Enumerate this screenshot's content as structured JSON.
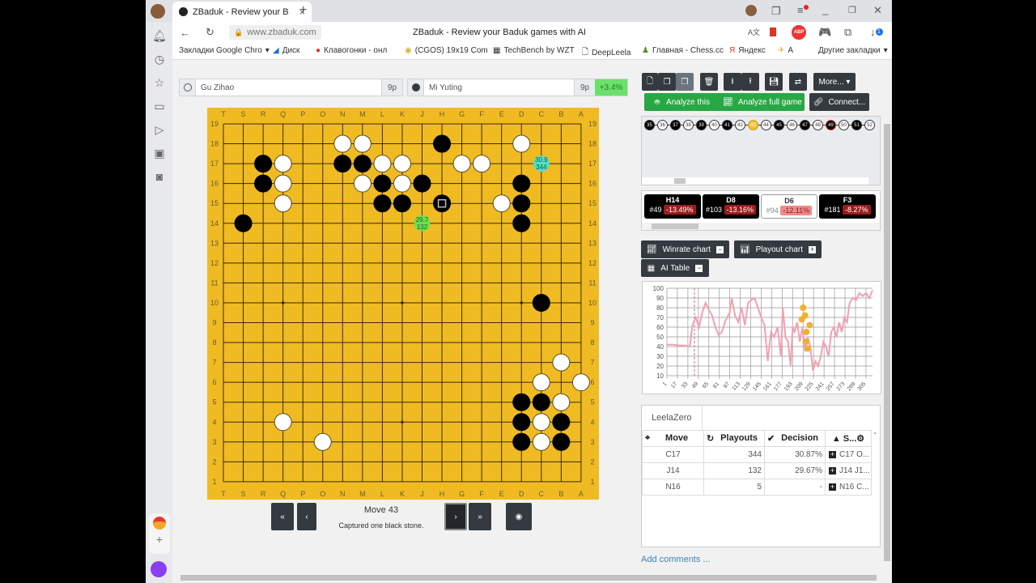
{
  "browser": {
    "tab_title": "ZBaduk - Review your B",
    "url": "www.zbaduk.com",
    "page_title": "ZBaduk - Review your Baduk games with AI",
    "bookmarks": [
      "Закладки Google Chro",
      "Диск",
      "Клавогонки - онл",
      "(CGOS) 19x19 Com",
      "TechBench by WZT",
      "DeepLeela",
      "Главная - Chess.cc",
      "Яндекс",
      "A"
    ],
    "other_bookmarks": "Другие закладки",
    "download_badge": "1",
    "extension_abp": "ABP"
  },
  "players": {
    "white": {
      "name": "Gu Zihao",
      "rank": "9p"
    },
    "black": {
      "name": "Mi Yuting",
      "rank": "9p",
      "delta": "+3.4%"
    }
  },
  "toolbar": {
    "more_label": "More...",
    "analyze_this": "Analyze this",
    "analyze_full": "Analyze full game",
    "connect": "Connect..."
  },
  "timeline": {
    "moves": [
      {
        "n": "35",
        "c": "b"
      },
      {
        "n": "36",
        "c": "w"
      },
      {
        "n": "37",
        "c": "b"
      },
      {
        "n": "38",
        "c": "w"
      },
      {
        "n": "39",
        "c": "b"
      },
      {
        "n": "40",
        "c": "w"
      },
      {
        "n": "41",
        "c": "b"
      },
      {
        "n": "42",
        "c": "w"
      },
      {
        "n": "43",
        "c": "cur"
      },
      {
        "n": "44",
        "c": "w"
      },
      {
        "n": "45",
        "c": "b"
      },
      {
        "n": "46",
        "c": "w"
      },
      {
        "n": "47",
        "c": "b"
      },
      {
        "n": "48",
        "c": "w"
      },
      {
        "n": "49",
        "c": "bad"
      },
      {
        "n": "50",
        "c": "w"
      },
      {
        "n": "51",
        "c": "b"
      },
      {
        "n": "52",
        "c": "w"
      }
    ]
  },
  "mistakes": [
    {
      "move": "H14",
      "num": "#49",
      "pct": "-13.49%",
      "style": "dark"
    },
    {
      "move": "D8",
      "num": "#103",
      "pct": "-13.16%",
      "style": "dark"
    },
    {
      "move": "D6",
      "num": "#94",
      "pct": "-12.11%",
      "style": "light"
    },
    {
      "move": "F3",
      "num": "#181",
      "pct": "-8.27%",
      "style": "dark"
    }
  ],
  "panels": {
    "winrate": "Winrate chart",
    "playout": "Playout chart",
    "aitable": "AI Table"
  },
  "chart_data": {
    "type": "line",
    "title": "",
    "xlabel": "",
    "ylabel": "",
    "ylim": [
      10,
      100
    ],
    "yticks": [
      10,
      20,
      30,
      40,
      50,
      60,
      70,
      80,
      90,
      100
    ],
    "xticks": [
      1,
      17,
      33,
      49,
      65,
      81,
      97,
      113,
      129,
      145,
      161,
      177,
      193,
      209,
      225,
      241,
      257,
      273,
      289,
      305
    ],
    "current_move": 43,
    "series": [
      {
        "name": "winrate",
        "color": "#f4a0b0",
        "x": [
          1,
          10,
          20,
          30,
          36,
          40,
          45,
          50,
          55,
          60,
          65,
          70,
          75,
          80,
          85,
          90,
          97,
          100,
          105,
          110,
          115,
          120,
          125,
          130,
          135,
          140,
          145,
          150,
          155,
          160,
          165,
          170,
          175,
          178,
          182,
          186,
          190,
          193,
          196,
          200,
          204,
          208,
          212,
          216,
          220,
          224,
          228,
          232,
          236,
          240,
          244,
          248,
          252,
          256,
          260,
          264,
          268,
          272,
          276,
          280,
          285,
          290,
          295,
          300,
          305,
          310,
          315
        ],
        "y": [
          42,
          42,
          41,
          41,
          40,
          62,
          70,
          60,
          75,
          85,
          78,
          72,
          60,
          52,
          55,
          66,
          75,
          90,
          72,
          65,
          80,
          62,
          85,
          88,
          90,
          80,
          70,
          62,
          25,
          55,
          50,
          60,
          30,
          80,
          50,
          45,
          20,
          60,
          55,
          65,
          45,
          60,
          35,
          50,
          40,
          15,
          25,
          20,
          30,
          45,
          40,
          30,
          55,
          60,
          50,
          65,
          55,
          70,
          65,
          85,
          90,
          88,
          95,
          92,
          95,
          90,
          98
        ]
      }
    ],
    "points": [
      {
        "x": 207,
        "y": 68
      },
      {
        "x": 209,
        "y": 80
      },
      {
        "x": 212,
        "y": 72
      },
      {
        "x": 214,
        "y": 55
      },
      {
        "x": 213,
        "y": 45
      },
      {
        "x": 216,
        "y": 38
      },
      {
        "x": 219,
        "y": 62
      }
    ],
    "grid": true
  },
  "ai": {
    "tab": "LeelaZero",
    "columns": [
      "Move",
      "Playouts",
      "Decision",
      "S..."
    ],
    "rows": [
      {
        "move": "C17",
        "playouts": "344",
        "decision": "30.87%",
        "seq": "C17 O..."
      },
      {
        "move": "J14",
        "playouts": "132",
        "decision": "29.67%",
        "seq": "J14 J1..."
      },
      {
        "move": "N16",
        "playouts": "5",
        "decision": "-",
        "seq": "N16 C..."
      }
    ]
  },
  "nav": {
    "move_label": "Move 43",
    "status": "Captured one black stone."
  },
  "comments_link": "Add comments ...",
  "board": {
    "columns": [
      "T",
      "S",
      "R",
      "Q",
      "P",
      "O",
      "N",
      "M",
      "L",
      "K",
      "J",
      "H",
      "G",
      "F",
      "E",
      "D",
      "C",
      "B",
      "A"
    ],
    "stones": [
      [
        "N18",
        "w"
      ],
      [
        "M18",
        "w"
      ],
      [
        "H18",
        "b"
      ],
      [
        "D18",
        "w"
      ],
      [
        "R17",
        "b"
      ],
      [
        "Q17",
        "w"
      ],
      [
        "N17",
        "b"
      ],
      [
        "M17",
        "b"
      ],
      [
        "L17",
        "w"
      ],
      [
        "K17",
        "w"
      ],
      [
        "G17",
        "w"
      ],
      [
        "F17",
        "w"
      ],
      [
        "R16",
        "b"
      ],
      [
        "Q16",
        "w"
      ],
      [
        "M16",
        "w"
      ],
      [
        "L16",
        "b"
      ],
      [
        "K16",
        "w"
      ],
      [
        "J16",
        "b"
      ],
      [
        "D16",
        "b"
      ],
      [
        "Q15",
        "w"
      ],
      [
        "L15",
        "b"
      ],
      [
        "K15",
        "b"
      ],
      [
        "H15",
        "b"
      ],
      [
        "E15",
        "w"
      ],
      [
        "D15",
        "b"
      ],
      [
        "S14",
        "b"
      ],
      [
        "D14",
        "b"
      ],
      [
        "C10",
        "b"
      ],
      [
        "B7",
        "w"
      ],
      [
        "C6",
        "w"
      ],
      [
        "A6",
        "w"
      ],
      [
        "D5",
        "b"
      ],
      [
        "C5",
        "b"
      ],
      [
        "B5",
        "w"
      ],
      [
        "Q4",
        "w"
      ],
      [
        "D4",
        "b"
      ],
      [
        "C4",
        "w"
      ],
      [
        "B4",
        "b"
      ],
      [
        "O3",
        "w"
      ],
      [
        "D3",
        "b"
      ],
      [
        "C3",
        "w"
      ],
      [
        "B3",
        "b"
      ]
    ],
    "last_move": "H15",
    "hints": [
      {
        "pos": "C17",
        "wr": "30.9",
        "po": "344",
        "color": "#4ee0c8"
      },
      {
        "pos": "J14",
        "wr": "29.7",
        "po": "132",
        "color": "#6ee04a"
      }
    ]
  }
}
